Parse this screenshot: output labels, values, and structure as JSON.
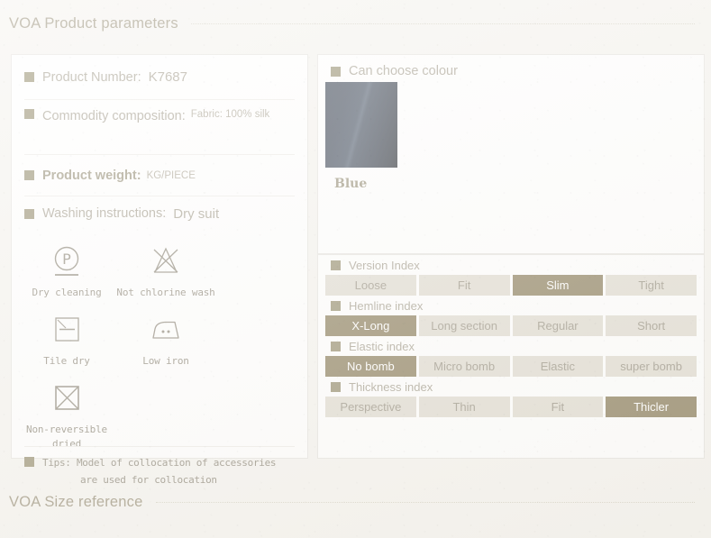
{
  "sections": {
    "params_title": "VOA Product parameters",
    "size_title": "VOA Size reference"
  },
  "left_card": {
    "product_number": {
      "label": "Product Number:",
      "value": "K7687"
    },
    "composition": {
      "label": "Commodity composition:",
      "value": "Fabric:  100%  silk"
    },
    "weight": {
      "label": "Product  weight:",
      "value": "KG/PIECE"
    },
    "washing": {
      "label": "Washing instructions:",
      "value": "Dry suit"
    },
    "wash_icons": [
      {
        "icon": "dry-cleaning-icon",
        "caption": "Dry cleaning"
      },
      {
        "icon": "no-chlorine-icon",
        "caption": "Not chlorine wash"
      },
      {
        "icon": "tile-dry-icon",
        "caption": "Tile dry"
      },
      {
        "icon": "low-iron-icon",
        "caption": "Low iron"
      },
      {
        "icon": "non-reversible-dried-icon",
        "caption": "Non-reversible\ndried"
      }
    ],
    "tips": {
      "label": "Tips:",
      "line1": "Model of collocation of accessories",
      "line2": "are used for collocation"
    }
  },
  "colour_card": {
    "label": "Can choose colour",
    "swatch_name": "Blue",
    "swatch_color": "#222c3d"
  },
  "index_card": {
    "accent_active": "#7d6e48",
    "accent_inactive": "#dcd7cb",
    "groups": [
      {
        "label": "Version Index",
        "options": [
          {
            "label": "Loose",
            "active": false
          },
          {
            "label": "Fit",
            "active": false
          },
          {
            "label": "Slim",
            "active": true
          },
          {
            "label": "Tight",
            "active": false
          }
        ]
      },
      {
        "label": "Hemline index",
        "options": [
          {
            "label": "X-Long",
            "active": true
          },
          {
            "label": "Long  section",
            "active": false
          },
          {
            "label": "Regular",
            "active": false
          },
          {
            "label": "Short",
            "active": false
          }
        ]
      },
      {
        "label": "Elastic index",
        "options": [
          {
            "label": "No  bomb",
            "active": true
          },
          {
            "label": "Micro  bomb",
            "active": false
          },
          {
            "label": "Elastic",
            "active": false
          },
          {
            "label": "super  bomb",
            "active": false
          }
        ]
      },
      {
        "label": "Thickness index",
        "options": [
          {
            "label": "Perspective",
            "active": false
          },
          {
            "label": "Thin",
            "active": false
          },
          {
            "label": "Fit",
            "active": false
          },
          {
            "label": "Thicler",
            "active": true
          }
        ]
      }
    ]
  }
}
